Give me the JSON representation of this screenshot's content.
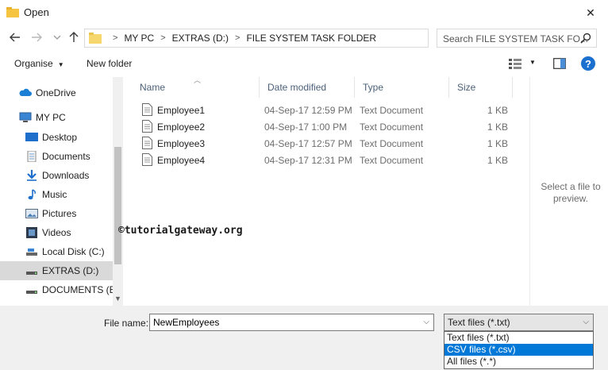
{
  "window": {
    "title": "Open",
    "close_label": "✕"
  },
  "navigation": {
    "back_icon": "back-arrow-icon",
    "forward_icon": "forward-arrow-icon",
    "recent_icon": "chevron-down-icon",
    "up_icon": "up-arrow-icon"
  },
  "address": {
    "crumbs": [
      "MY PC",
      "EXTRAS (D:)",
      "FILE SYSTEM TASK FOLDER"
    ],
    "separator": ">"
  },
  "search": {
    "placeholder": "Search FILE SYSTEM TASK FO..."
  },
  "toolbar": {
    "organise_label": "Organise",
    "new_folder_label": "New folder",
    "help_label": "?"
  },
  "sidebar": {
    "items": [
      {
        "label": "OneDrive",
        "icon": "cloud-icon"
      },
      {
        "label": "MY PC",
        "icon": "computer-icon"
      },
      {
        "label": "Desktop",
        "icon": "desktop-icon"
      },
      {
        "label": "Documents",
        "icon": "documents-icon"
      },
      {
        "label": "Downloads",
        "icon": "download-icon"
      },
      {
        "label": "Music",
        "icon": "music-icon"
      },
      {
        "label": "Pictures",
        "icon": "pictures-icon"
      },
      {
        "label": "Videos",
        "icon": "videos-icon"
      },
      {
        "label": "Local Disk (C:)",
        "icon": "drive-icon"
      },
      {
        "label": "EXTRAS (D:)",
        "icon": "drive-icon",
        "selected": true
      },
      {
        "label": "DOCUMENTS (E",
        "icon": "drive-icon"
      }
    ]
  },
  "files": {
    "columns": {
      "name": "Name",
      "date": "Date modified",
      "type": "Type",
      "size": "Size"
    },
    "rows": [
      {
        "name": "Employee1",
        "date": "04-Sep-17 12:59 PM",
        "type": "Text Document",
        "size": "1 KB"
      },
      {
        "name": "Employee2",
        "date": "04-Sep-17 1:00 PM",
        "type": "Text Document",
        "size": "1 KB"
      },
      {
        "name": "Employee3",
        "date": "04-Sep-17 12:57 PM",
        "type": "Text Document",
        "size": "1 KB"
      },
      {
        "name": "Employee4",
        "date": "04-Sep-17 12:31 PM",
        "type": "Text Document",
        "size": "1 KB"
      }
    ]
  },
  "preview": {
    "line1": "Select a file to",
    "line2": "preview."
  },
  "watermark": "©tutorialgateway.org",
  "bottom": {
    "file_name_label": "File name:",
    "file_name_value": "NewEmployees",
    "file_type_selected": "Text files (*.txt)",
    "file_type_options": [
      "Text files (*.txt)",
      "CSV files (*.csv)",
      "All files (*.*)"
    ],
    "highlighted_option_index": 1
  },
  "colors": {
    "accent": "#0078d7",
    "help": "#1a6fcf",
    "folder": "#f5d76e"
  }
}
